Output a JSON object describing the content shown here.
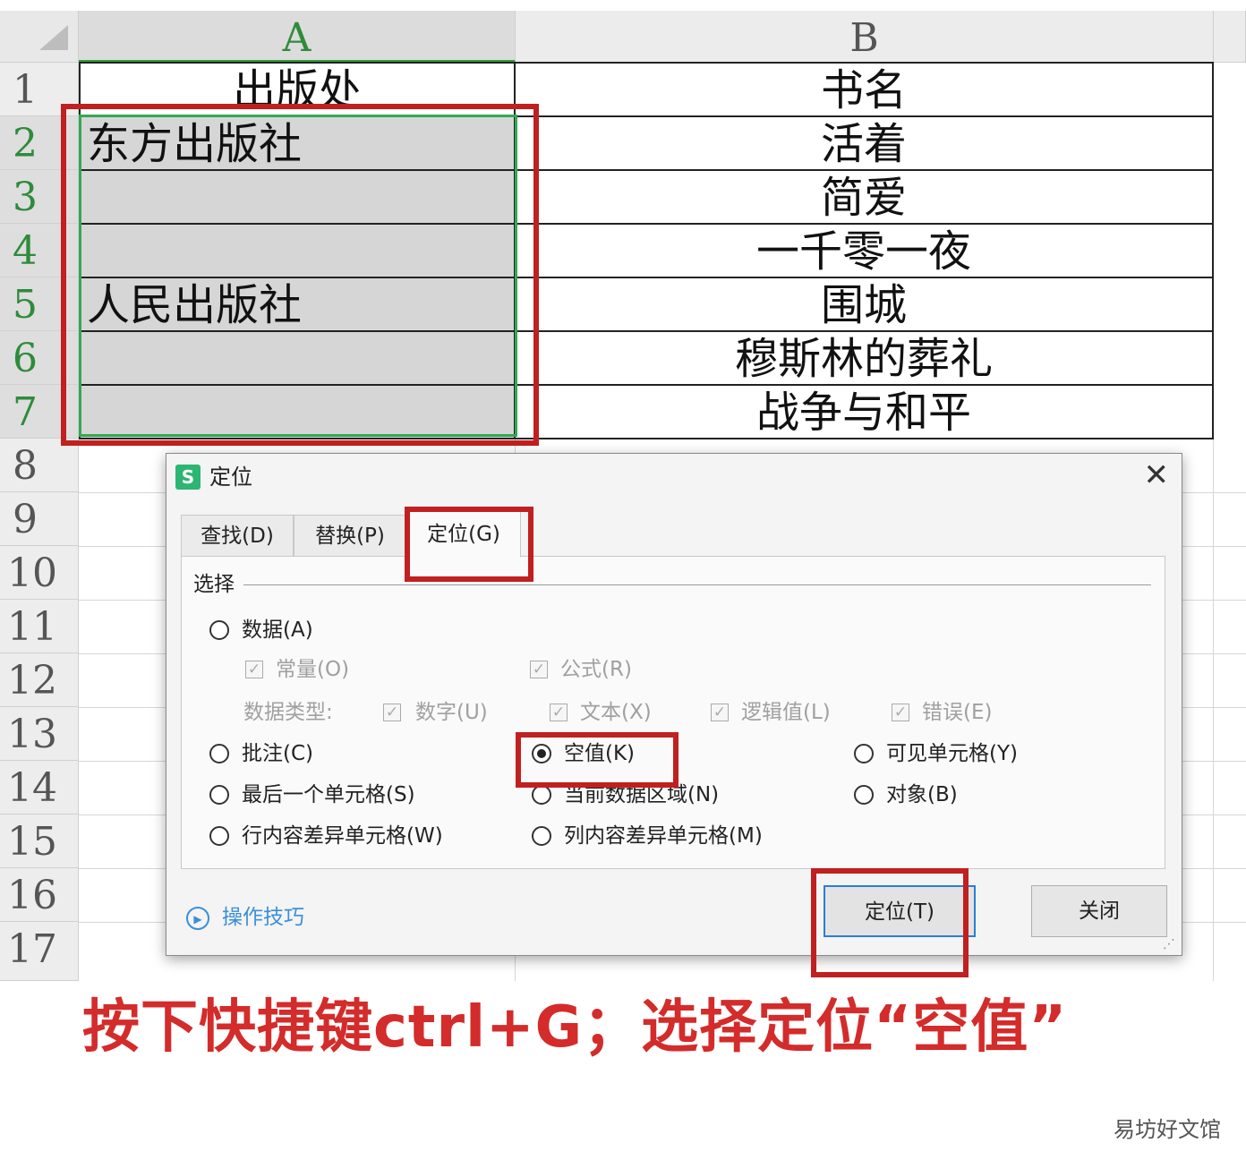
{
  "sheet": {
    "columns": [
      "A",
      "B"
    ],
    "rows": [
      "1",
      "2",
      "3",
      "4",
      "5",
      "6",
      "7",
      "8",
      "9",
      "10",
      "11",
      "12",
      "13",
      "14",
      "15",
      "16",
      "17"
    ],
    "colA": [
      "出版处",
      "东方出版社",
      "",
      "",
      "人民出版社",
      "",
      ""
    ],
    "colB": [
      "书名",
      "活着",
      "简爱",
      "一千零一夜",
      "围城",
      "穆斯林的葬礼",
      "战争与和平"
    ]
  },
  "dialog": {
    "logo": "S",
    "title": "定位",
    "close_glyph": "✕",
    "tabs": [
      "查找(D)",
      "替换(P)",
      "定位(G)"
    ],
    "group_label": "选择",
    "options": {
      "data": "数据(A)",
      "constant": "常量(O)",
      "formula": "公式(R)",
      "data_type_label": "数据类型:",
      "number": "数字(U)",
      "text": "文本(X)",
      "logical": "逻辑值(L)",
      "error": "错误(E)",
      "comment": "批注(C)",
      "blank": "空值(K)",
      "visible": "可见单元格(Y)",
      "last_cell": "最后一个单元格(S)",
      "current_region": "当前数据区域(N)",
      "object": "对象(B)",
      "row_diff": "行内容差异单元格(W)",
      "col_diff": "列内容差异单元格(M)"
    },
    "selected_option": "空值(K)",
    "tips": "操作技巧",
    "buttons": {
      "locate": "定位(T)",
      "close": "关闭"
    }
  },
  "caption": "按下快捷键ctrl+G；选择定位“空值”",
  "watermark": "易坊好文馆",
  "colors": {
    "highlight_red": "#c0201f",
    "selection_green": "#34a853",
    "link_blue": "#3b8fd9"
  }
}
